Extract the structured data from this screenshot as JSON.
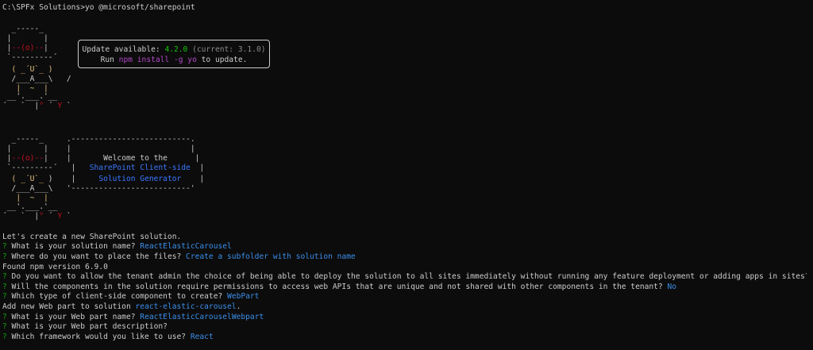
{
  "prompt": {
    "path": "C:\\SPFx Solutions>",
    "command": "yo @microsoft/sharepoint"
  },
  "yeoman_art_1": {
    "l1": "  _-----_",
    "l2": " |       |",
    "l3a": " |",
    "l3b": "--(o)--",
    "l3c": "|",
    "l4": " `---------´",
    "l5a": "  ( ",
    "l5b": "_´U`_",
    "l5c": " )",
    "l6": "  /___A___\\   /",
    "l7a": "   |  ",
    "l7b": "~",
    "l7c": "  |",
    "l8": " __'.___.'__",
    "l9a": "´   `  |",
    "l9b": "°",
    "l9c": " ´ ",
    "l9d": "Y",
    "l9e": " `"
  },
  "update_notice": {
    "line1_prefix": "Update available: ",
    "new_version": "4.2.0",
    "current": " (current: 3.1.0)",
    "line2_prefix": "Run ",
    "command": "npm install -g yo",
    "line2_suffix": " to update."
  },
  "yeoman_art_2": {
    "l1": "  _-----_     ",
    "l1b": ".--------------------------.",
    "l2": " |       |    |                          |",
    "l3a": " |",
    "l3b": "--(o)--",
    "l3c": "|    |       Welcome to the      |",
    "l4": " `---------´   |   ",
    "l4b": "SharePoint Client-side",
    "l4c": "  |",
    "l5a": "  ( ",
    "l5b": "_´U`_",
    "l5c": " )    |     ",
    "l5d": "Solution Generator",
    "l5e": "    |",
    "l6": "  /___A___\\   '--------------------------'",
    "l7a": "   |  ",
    "l7b": "~",
    "l7c": "  |",
    "l8": " __'.___.'__",
    "l9a": "´   `  |",
    "l9b": "°",
    "l9c": " ´ ",
    "l9d": "Y",
    "l9e": " `"
  },
  "session": {
    "intro": "Let's create a new SharePoint solution.",
    "q_marker": "?",
    "q1": " What is your solution name? ",
    "a1": "ReactElasticCarousel",
    "q2": " Where do you want to place the files? ",
    "a2": "Create a subfolder with solution name",
    "npm_version": "Found npm version 6.9.0",
    "q3": " Do you want to allow the tenant admin the choice of being able to deploy the solution to all sites immediately without running any feature deployment or adding apps in sites? ",
    "a3": "No",
    "q4": " Will the components in the solution require permissions to access web APIs that are unique and not shared with other components in the tenant? ",
    "a4": "No",
    "q5": " Which type of client-side component to create? ",
    "a5": "WebPart",
    "add_webpart_prefix": "Add new Web part to solution ",
    "add_webpart_name": "react-elastic-carousel",
    "add_webpart_suffix": ".",
    "q6": " What is your Web part name? ",
    "a6": "ReactElasticCarouselWebpart",
    "q7": " What is your Web part description?",
    "q8": " Which framework would you like to use? ",
    "a8": "React"
  },
  "colors": {
    "background": "#0c0c0c",
    "text": "#cccccc",
    "question_marker": "#13a10e",
    "answer": "#3b8eea",
    "accent_red": "#c50f1f",
    "accent_yellow": "#e5c07b",
    "accent_green": "#16c60c",
    "accent_magenta": "#b148c6"
  }
}
